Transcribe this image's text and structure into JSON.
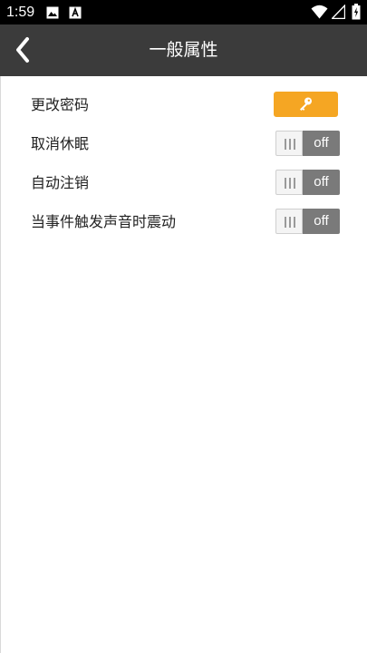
{
  "status_bar": {
    "time": "1:59",
    "icons": [
      "image-icon",
      "a-letter-icon",
      "wifi-icon",
      "signal-icon",
      "battery-icon"
    ]
  },
  "app_bar": {
    "title": "一般属性",
    "back_icon": "chevron-left-icon",
    "background": "#3b3b3b"
  },
  "settings": {
    "change_password": {
      "label": "更改密码",
      "button_icon": "key-icon",
      "button_color": "#f5a623"
    },
    "cancel_sleep": {
      "label": "取消休眠",
      "toggle_state": "off"
    },
    "auto_logout": {
      "label": "自动注销",
      "toggle_state": "off"
    },
    "vibrate_on_event": {
      "label": "当事件触发声音时震动",
      "toggle_state": "off"
    }
  }
}
